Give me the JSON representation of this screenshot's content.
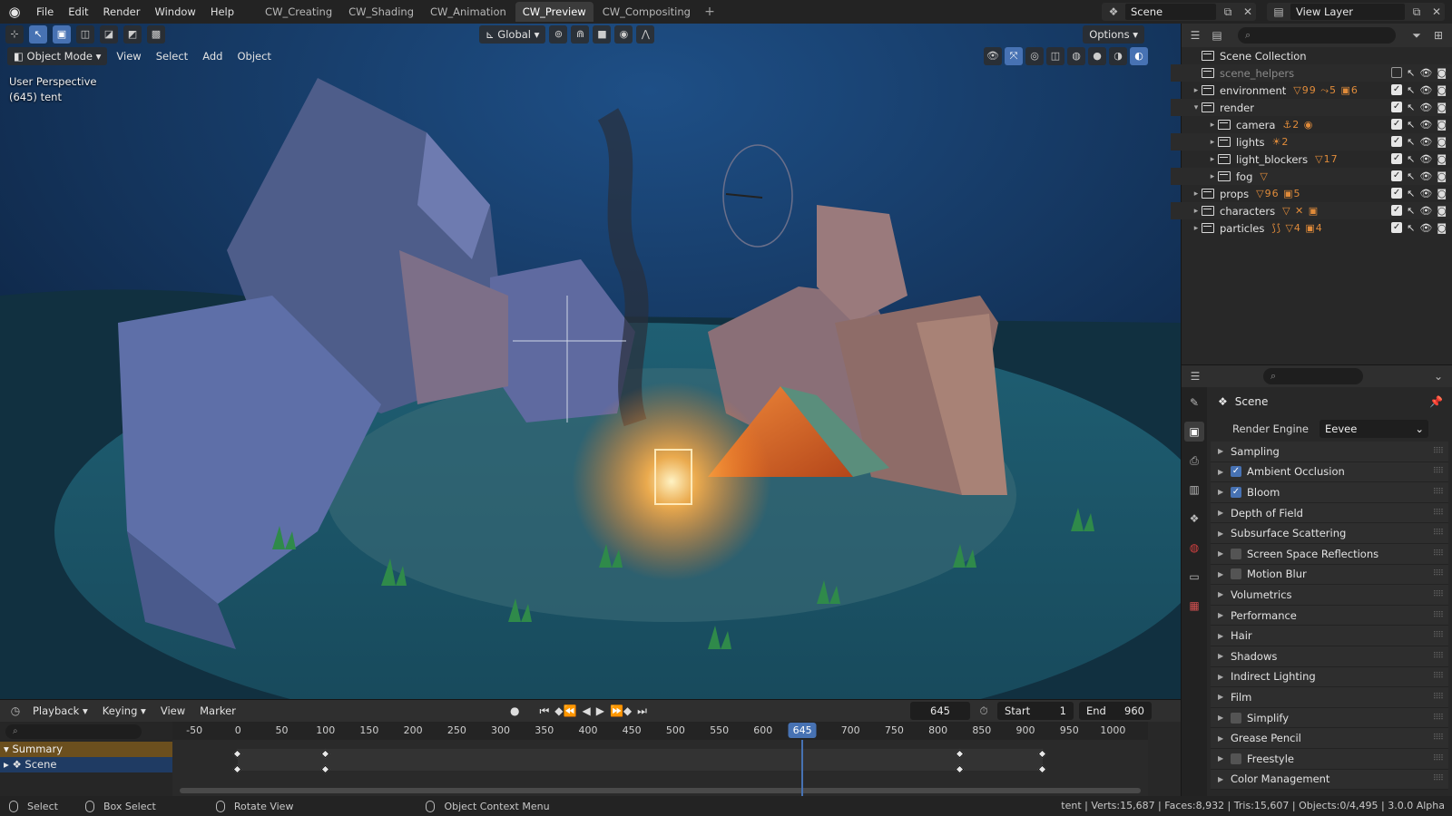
{
  "topbar": {
    "menus": [
      "File",
      "Edit",
      "Render",
      "Window",
      "Help"
    ],
    "workspaces": [
      "CW_Creating",
      "CW_Shading",
      "CW_Animation",
      "CW_Preview",
      "CW_Compositing"
    ],
    "active_workspace": "CW_Preview",
    "scene": "Scene",
    "view_layer": "View Layer"
  },
  "viewport": {
    "transform": "Global",
    "options": "Options",
    "mode": "Object Mode",
    "menus": [
      "View",
      "Select",
      "Add",
      "Object"
    ],
    "perspective": "User Perspective",
    "object_info": "(645) tent"
  },
  "outliner": {
    "root": "Scene Collection",
    "rows": [
      {
        "name": "scene_helpers",
        "badges": "",
        "indent": 0,
        "arrow": "",
        "checked": false
      },
      {
        "name": "environment",
        "badges": "▽99 ⤳5 ▣6",
        "indent": 0,
        "arrow": "▸",
        "checked": true
      },
      {
        "name": "render",
        "badges": "",
        "indent": 0,
        "arrow": "▾",
        "checked": true
      },
      {
        "name": "camera",
        "badges": "⚓2 ◉",
        "indent": 1,
        "arrow": "▸",
        "checked": true
      },
      {
        "name": "lights",
        "badges": "☀2",
        "indent": 1,
        "arrow": "▸",
        "checked": true
      },
      {
        "name": "light_blockers",
        "badges": "▽17",
        "indent": 1,
        "arrow": "▸",
        "checked": true
      },
      {
        "name": "fog",
        "badges": "▽",
        "indent": 1,
        "arrow": "▸",
        "checked": true
      },
      {
        "name": "props",
        "badges": "▽96 ▣5",
        "indent": 0,
        "arrow": "▸",
        "checked": true
      },
      {
        "name": "characters",
        "badges": "▽ ✕ ▣",
        "indent": 0,
        "arrow": "▸",
        "checked": true
      },
      {
        "name": "particles",
        "badges": "⟆⟆ ▽4 ▣4",
        "indent": 0,
        "arrow": "▸",
        "checked": true
      }
    ]
  },
  "properties": {
    "context": "Scene",
    "render_engine_label": "Render Engine",
    "render_engine": "Eevee",
    "panels": [
      {
        "label": "Sampling",
        "check": null
      },
      {
        "label": "Ambient Occlusion",
        "check": true
      },
      {
        "label": "Bloom",
        "check": true
      },
      {
        "label": "Depth of Field",
        "check": null
      },
      {
        "label": "Subsurface Scattering",
        "check": null
      },
      {
        "label": "Screen Space Reflections",
        "check": false
      },
      {
        "label": "Motion Blur",
        "check": false
      },
      {
        "label": "Volumetrics",
        "check": null
      },
      {
        "label": "Performance",
        "check": null
      },
      {
        "label": "Hair",
        "check": null
      },
      {
        "label": "Shadows",
        "check": null
      },
      {
        "label": "Indirect Lighting",
        "check": null
      },
      {
        "label": "Film",
        "check": null
      },
      {
        "label": "Simplify",
        "check": false
      },
      {
        "label": "Grease Pencil",
        "check": null
      },
      {
        "label": "Freestyle",
        "check": false
      },
      {
        "label": "Color Management",
        "check": null
      }
    ]
  },
  "timeline": {
    "menus": [
      "Playback",
      "Keying",
      "View",
      "Marker"
    ],
    "current_frame": "645",
    "start_label": "Start",
    "start": "1",
    "end_label": "End",
    "end": "960",
    "ticks": [
      "-50",
      "0",
      "50",
      "100",
      "150",
      "200",
      "250",
      "300",
      "350",
      "400",
      "450",
      "500",
      "550",
      "600",
      "650",
      "700",
      "750",
      "800",
      "850",
      "900",
      "950",
      "1000"
    ],
    "rows": [
      "Summary",
      "Scene"
    ],
    "keyframes": [
      0,
      100,
      825,
      920
    ]
  },
  "statusbar": {
    "items": [
      "Select",
      "Box Select",
      "Rotate View",
      "Object Context Menu"
    ],
    "stats": "tent | Verts:15,687 | Faces:8,932 | Tris:15,607 | Objects:0/4,495 | 3.0.0 Alpha"
  },
  "colors": {
    "accent": "#4772b3",
    "keyframe_row": "#6b4f1e",
    "scene_row": "#1f3b63",
    "badge": "#e08b3a"
  }
}
